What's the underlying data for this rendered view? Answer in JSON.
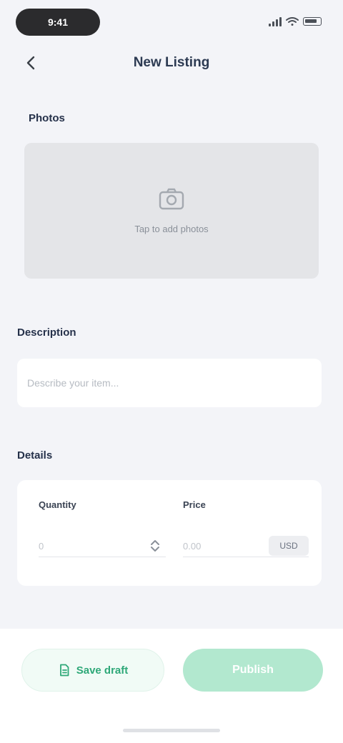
{
  "status_bar": {
    "time": "9:41"
  },
  "nav": {
    "title": "New Listing",
    "back_icon": "chevron-left-icon"
  },
  "photos": {
    "label": "Photos",
    "upload_icon": "camera-icon",
    "hint": "Tap to add photos"
  },
  "description": {
    "label": "Description",
    "placeholder": "Describe your item..."
  },
  "details": {
    "label": "Details",
    "quantity": {
      "label": "Quantity",
      "placeholder": "0",
      "icon": "stepper-icon"
    },
    "price": {
      "label": "Price",
      "placeholder": "0.00",
      "unit": "USD"
    }
  },
  "actions": {
    "secondary_label": "Save draft",
    "secondary_icon": "document-icon",
    "primary_label": "Publish"
  },
  "colors": {
    "accent": "#2ea878",
    "primary_button": "#b2e8cf",
    "background": "#f3f4f8"
  }
}
